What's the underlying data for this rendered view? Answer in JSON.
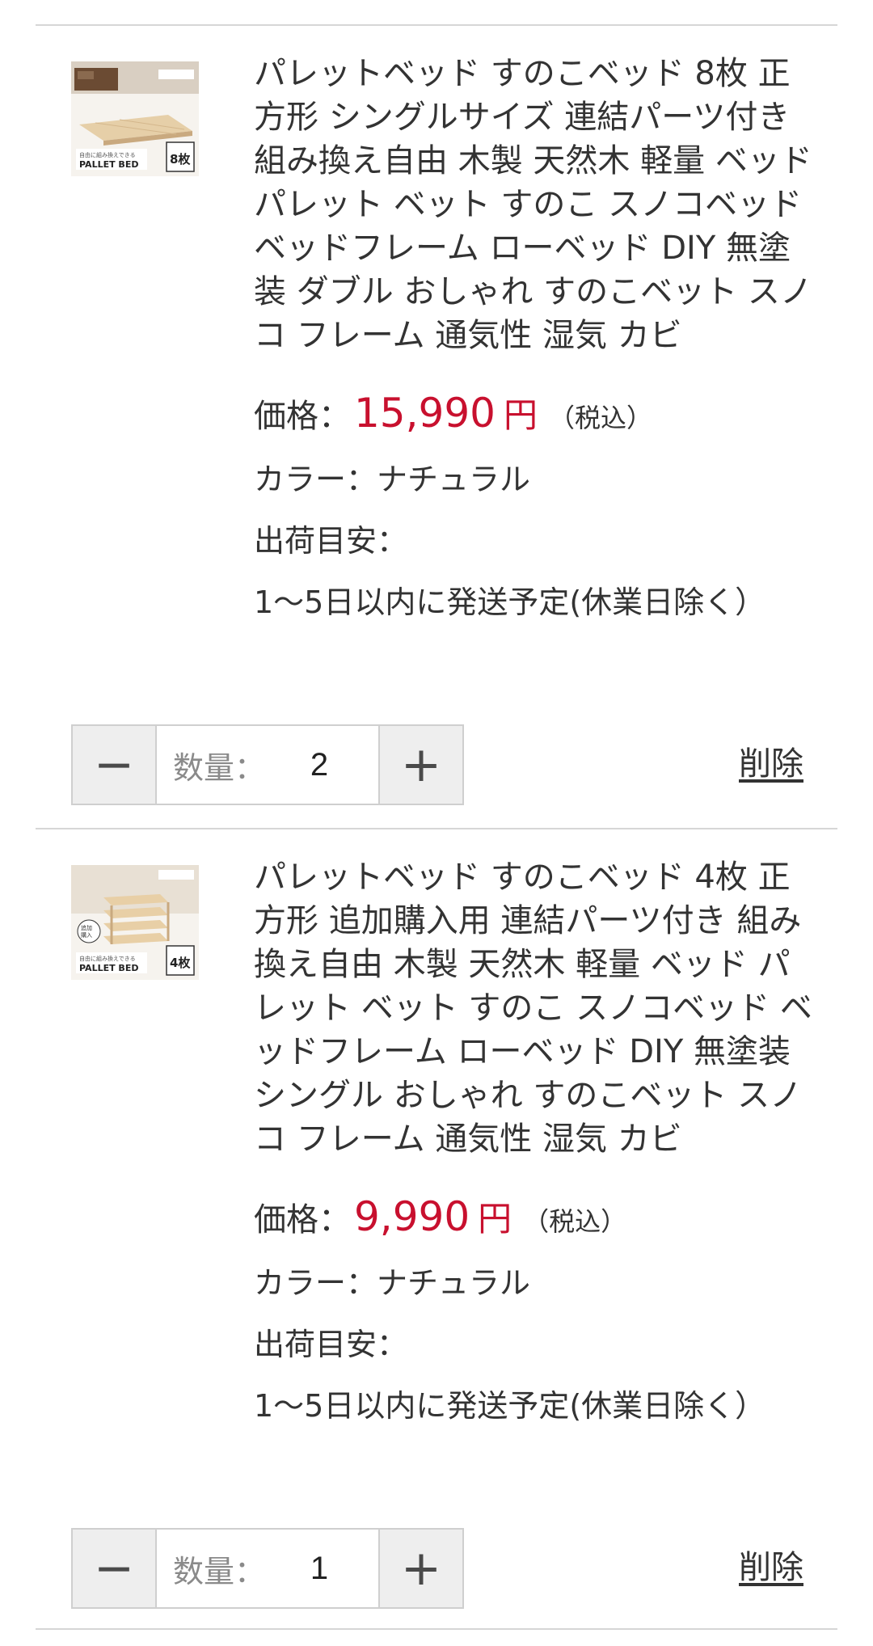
{
  "cart": {
    "items": [
      {
        "title": "パレットベッド すのこベッド 8枚 正方形 シングルサイズ 連結パーツ付き 組み換え自由 木製 天然木 軽量 ベッド パレット ベット すのこ スノコベッド ベッドフレーム ローベッド DIY 無塗装 ダブル おしゃれ すのこベット スノコ フレーム 通気性 湿気 カビ",
        "price_label": "価格：",
        "price_value": "15,990",
        "currency": "円",
        "tax_note": "（税込）",
        "color_line": "カラー：ナチュラル",
        "ship_label": "出荷目安：",
        "ship_value": "1〜5日以内に発送予定(休業日除く）",
        "qty_label": "数量：",
        "qty_value": "2",
        "minus_label": "−",
        "plus_label": "+",
        "delete_label": "削除",
        "thumb": {
          "brand": "PALLET BED",
          "count_badge": "8枚"
        }
      },
      {
        "title": "パレットベッド すのこベッド 4枚 正方形 追加購入用 連結パーツ付き 組み換え自由 木製 天然木 軽量 ベッド パレット ベット すのこ スノコベッド ベッドフレーム ローベッド DIY 無塗装 シングル おしゃれ すのこベット スノコ フレーム 通気性 湿気 カビ",
        "price_label": "価格：",
        "price_value": "9,990",
        "currency": "円",
        "tax_note": "（税込）",
        "color_line": "カラー：ナチュラル",
        "ship_label": "出荷目安：",
        "ship_value": "1〜5日以内に発送予定(休業日除く）",
        "qty_label": "数量：",
        "qty_value": "1",
        "minus_label": "−",
        "plus_label": "+",
        "delete_label": "削除",
        "thumb": {
          "brand": "PALLET BED",
          "count_badge": "4枚"
        }
      }
    ]
  },
  "colors": {
    "price": "#c8102e",
    "divider": "#d6d6d6",
    "button_bg": "#eeeeee"
  }
}
